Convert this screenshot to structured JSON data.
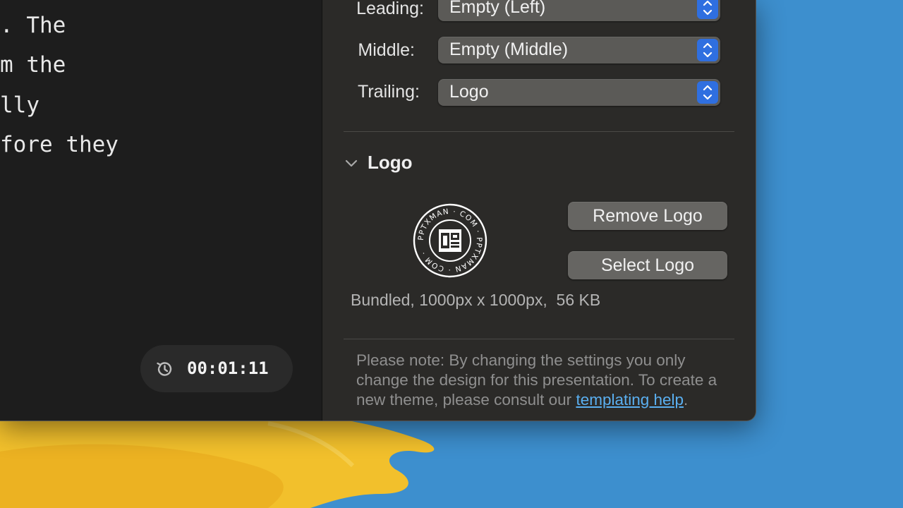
{
  "editor": {
    "lines": [
      ". The",
      "m the",
      "lly",
      "fore they"
    ]
  },
  "timer": {
    "icon": "history-clock-icon",
    "value": "00:01:11"
  },
  "header_rows": [
    {
      "label": "Leading:",
      "value": "Empty (Left)"
    },
    {
      "label": "Middle:",
      "value": "Empty (Middle)"
    },
    {
      "label": "Trailing:",
      "value": "Logo"
    }
  ],
  "logo_section": {
    "title": "Logo",
    "remove_label": "Remove Logo",
    "select_label": "Select Logo",
    "meta": "Bundled, 1000px x 1000px,  56 KB",
    "logo_ring_text": "PPTXMAN · COM · PPTXMAN · COM ·"
  },
  "note": {
    "text": "Please note: By changing the settings you only change the design for this presentation. To create a new theme, please consult our ",
    "link": "templating help",
    "tail": "."
  },
  "colors": {
    "accent": "#2f6fe0",
    "link": "#5aaff0",
    "desktop_blue": "#3d8fce",
    "desktop_yellow": "#f2c02c"
  }
}
